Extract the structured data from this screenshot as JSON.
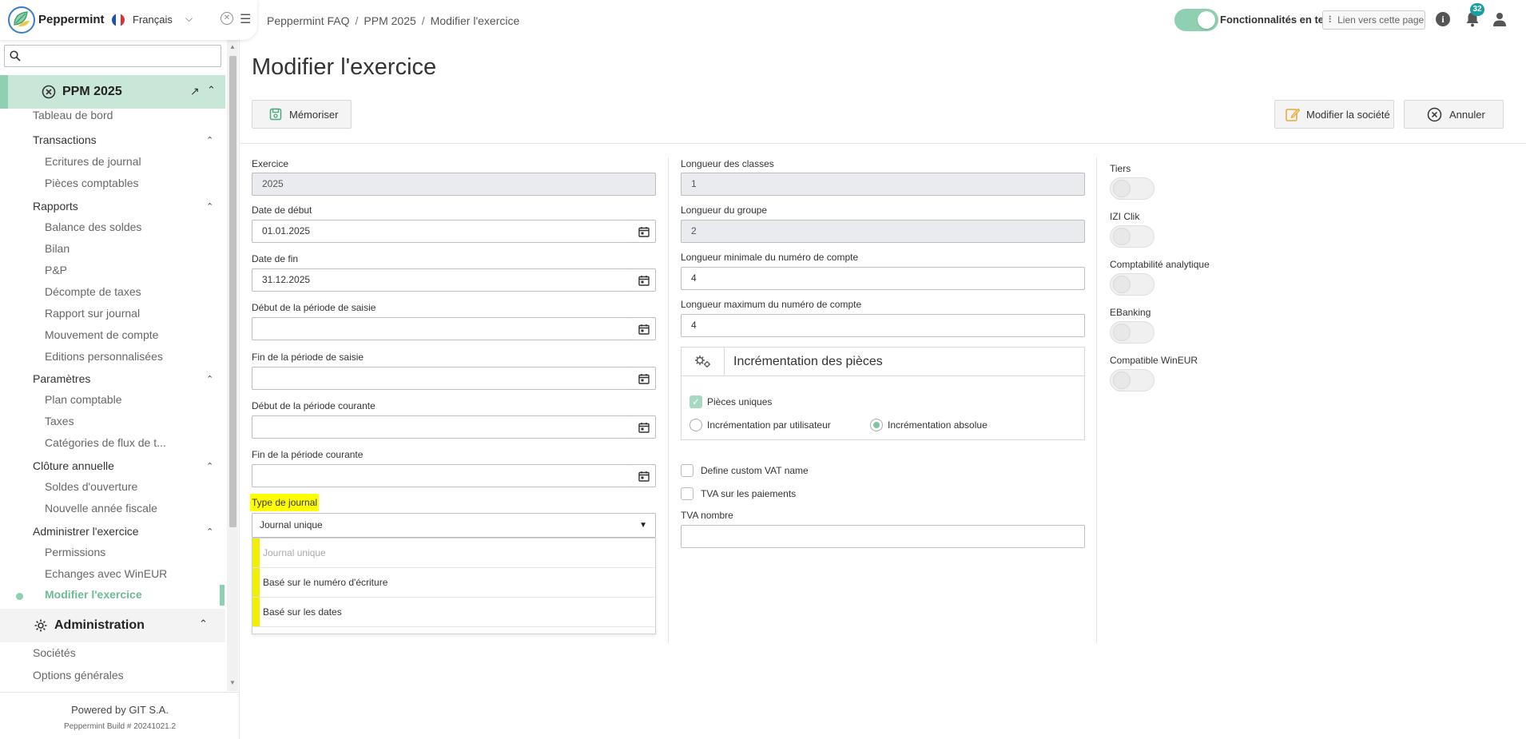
{
  "app": {
    "name": "Peppermint",
    "language": "Français",
    "powered_by": "Powered by GIT S.A.",
    "build": "Peppermint Build # 20241021.2"
  },
  "breadcrumb": [
    "Peppermint FAQ",
    "PPM 2025",
    "Modifier l'exercice"
  ],
  "topbar": {
    "test_features_label": "Fonctionnalités en test",
    "test_features_on": true,
    "link_page_label": "Lien vers cette page",
    "notification_count": "32"
  },
  "sidebar": {
    "search_placeholder": "",
    "project": "PPM 2025",
    "dashboard": "Tableau de bord",
    "sections": [
      {
        "title": "Transactions",
        "items": [
          "Ecritures de journal",
          "Pièces comptables"
        ]
      },
      {
        "title": "Rapports",
        "items": [
          "Balance des soldes",
          "Bilan",
          "P&P",
          "Décompte de taxes",
          "Rapport sur journal",
          "Mouvement de compte",
          "Editions personnalisées"
        ]
      },
      {
        "title": "Paramètres",
        "items": [
          "Plan comptable",
          "Taxes",
          "Catégories de flux de t..."
        ]
      },
      {
        "title": "Clôture annuelle",
        "items": [
          "Soldes d'ouverture",
          "Nouvelle année fiscale"
        ]
      },
      {
        "title": "Administrer l'exercice",
        "items": [
          "Permissions",
          "Echanges avec WinEUR",
          "Modifier l'exercice"
        ]
      }
    ],
    "admin_title": "Administration",
    "admin_items": [
      "Sociétés",
      "Options générales"
    ]
  },
  "page": {
    "title": "Modifier l'exercice",
    "save_label": "Mémoriser",
    "company_label": "Modifier la société",
    "cancel_label": "Annuler"
  },
  "form_left": {
    "exercice_label": "Exercice",
    "exercice_value": "2025",
    "start_label": "Date de début",
    "start_value": "01.01.2025",
    "end_label": "Date de fin",
    "end_value": "31.12.2025",
    "entry_start_label": "Début de la période de saisie",
    "entry_start_value": "",
    "entry_end_label": "Fin de la période de saisie",
    "entry_end_value": "",
    "current_start_label": "Début de la période courante",
    "current_start_value": "",
    "current_end_label": "Fin de la période courante",
    "current_end_value": "",
    "journal_type_label": "Type de journal",
    "journal_type_value": "Journal unique",
    "journal_options": [
      "Journal unique",
      "Basé sur le numéro d'écriture",
      "Basé sur les dates"
    ]
  },
  "form_mid": {
    "class_len_label": "Longueur des classes",
    "class_len_value": "1",
    "group_len_label": "Longueur du groupe",
    "group_len_value": "2",
    "min_acc_label": "Longueur minimale du numéro de compte",
    "min_acc_value": "4",
    "max_acc_label": "Longueur maximum du numéro de compte",
    "max_acc_value": "4",
    "incr_title": "Incrémentation des pièces",
    "unique_label": "Pièces uniques",
    "unique_checked": true,
    "per_user_label": "Incrémentation par utilisateur",
    "absolute_label": "Incrémentation absolue",
    "increment_mode": "absolute",
    "custom_vat_label": "Define custom VAT name",
    "custom_vat_checked": false,
    "vat_payments_label": "TVA sur les paiements",
    "vat_payments_checked": false,
    "vat_number_label": "TVA nombre",
    "vat_number_value": ""
  },
  "form_right": {
    "toggles": [
      {
        "label": "Tiers",
        "on": false
      },
      {
        "label": "IZI Clik",
        "on": false
      },
      {
        "label": "Comptabilité analytique",
        "on": false
      },
      {
        "label": "EBanking",
        "on": false
      },
      {
        "label": "Compatible WinEUR",
        "on": false
      }
    ]
  },
  "colors": {
    "accent": "#8fd0b2",
    "accent_light": "#c9e7d8",
    "highlight": "#ffff00",
    "badge": "#1aa0a0"
  }
}
